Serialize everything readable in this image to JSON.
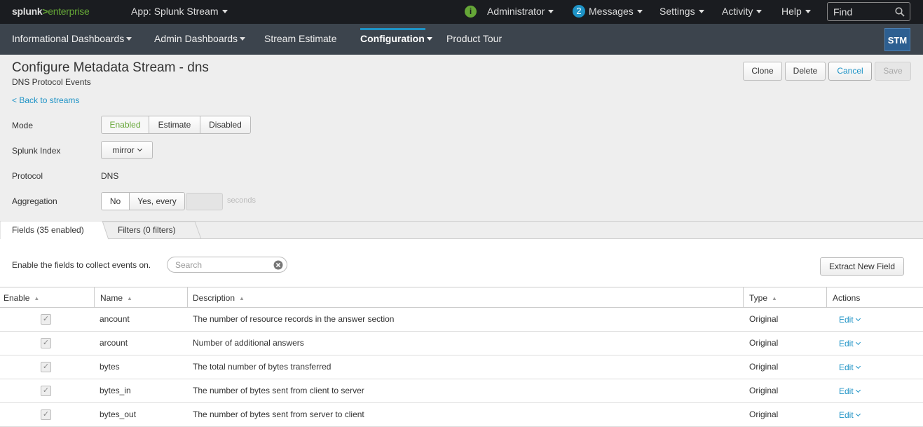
{
  "topbar": {
    "logo_prefix": "splunk",
    "logo_gt": ">",
    "logo_suffix": "enterprise",
    "app_label": "App: Splunk Stream",
    "status_glyph": "i",
    "user": "Administrator",
    "messages_count": "2",
    "messages_label": "Messages",
    "settings": "Settings",
    "activity": "Activity",
    "help": "Help",
    "find_placeholder": "Find",
    "search_icon": "search-icon",
    "accent": "#65a637"
  },
  "appbar": {
    "items": [
      {
        "label": "Informational Dashboards"
      },
      {
        "label": "Admin Dashboards"
      },
      {
        "label": "Stream Estimate"
      },
      {
        "label": "Configuration"
      },
      {
        "label": "Product Tour"
      }
    ],
    "app_icon": "STM",
    "active_color": "#1e93c6"
  },
  "page": {
    "title": "Configure Metadata Stream - dns",
    "subtitle": "DNS Protocol Events",
    "back": "< Back to streams",
    "buttons": {
      "clone": "Clone",
      "delete": "Delete",
      "cancel": "Cancel",
      "save": "Save"
    }
  },
  "form": {
    "mode_label": "Mode",
    "mode_options": [
      "Enabled",
      "Estimate",
      "Disabled"
    ],
    "mode_selected": "Enabled",
    "index_label": "Splunk Index",
    "index_value": "mirror",
    "protocol_label": "Protocol",
    "protocol_value": "DNS",
    "aggregation_label": "Aggregation",
    "aggregation_options": [
      "No",
      "Yes, every"
    ],
    "aggregation_seconds_value": "",
    "aggregation_unit": "seconds"
  },
  "tabs": {
    "fields": "Fields (35 enabled)",
    "filters": "Filters (0 filters)"
  },
  "fields_panel": {
    "hint": "Enable the fields to collect events on.",
    "search_placeholder": "Search",
    "extract_button": "Extract New Field"
  },
  "table": {
    "headers": {
      "enable": "Enable",
      "name": "Name",
      "description": "Description",
      "type": "Type",
      "actions": "Actions"
    },
    "rows": [
      {
        "enabled": true,
        "name": "ancount",
        "description": "The number of resource records in the answer section",
        "type": "Original",
        "action": "Edit"
      },
      {
        "enabled": true,
        "name": "arcount",
        "description": "Number of additional answers",
        "type": "Original",
        "action": "Edit"
      },
      {
        "enabled": true,
        "name": "bytes",
        "description": "The total number of bytes transferred",
        "type": "Original",
        "action": "Edit"
      },
      {
        "enabled": true,
        "name": "bytes_in",
        "description": "The number of bytes sent from client to server",
        "type": "Original",
        "action": "Edit"
      },
      {
        "enabled": true,
        "name": "bytes_out",
        "description": "The number of bytes sent from server to client",
        "type": "Original",
        "action": "Edit"
      }
    ]
  }
}
